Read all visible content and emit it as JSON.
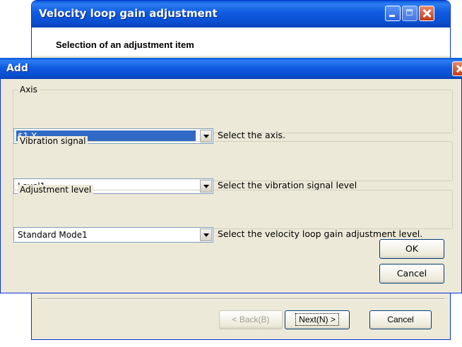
{
  "wizard": {
    "title": "Velocity loop gain adjustment",
    "heading": "Selection of an adjustment item",
    "back_label": "< Back(B)",
    "next_label": "Next(N) >",
    "cancel_label": "Cancel"
  },
  "dialog": {
    "title": "Add",
    "groups": {
      "axis": {
        "legend": "Axis",
        "value": "$1-X",
        "hint": "Select the axis."
      },
      "vibration": {
        "legend": "Vibration signal",
        "value": "Level1",
        "hint": "Select the vibration signal level"
      },
      "adjustment": {
        "legend": "Adjustment level",
        "value": "Standard Mode1",
        "hint": "Select the velocity loop gain adjustment level."
      }
    },
    "ok_label": "OK",
    "cancel_label": "Cancel"
  },
  "icons": {
    "minimize": "minimize-icon",
    "maximize": "maximize-icon",
    "close": "close-icon",
    "dropdown": "chevron-down-icon"
  },
  "colors": {
    "titlebar": "#0a5bd6",
    "dialog_face": "#ece9d8",
    "selection": "#316ac5",
    "close_button": "#c43a18"
  }
}
